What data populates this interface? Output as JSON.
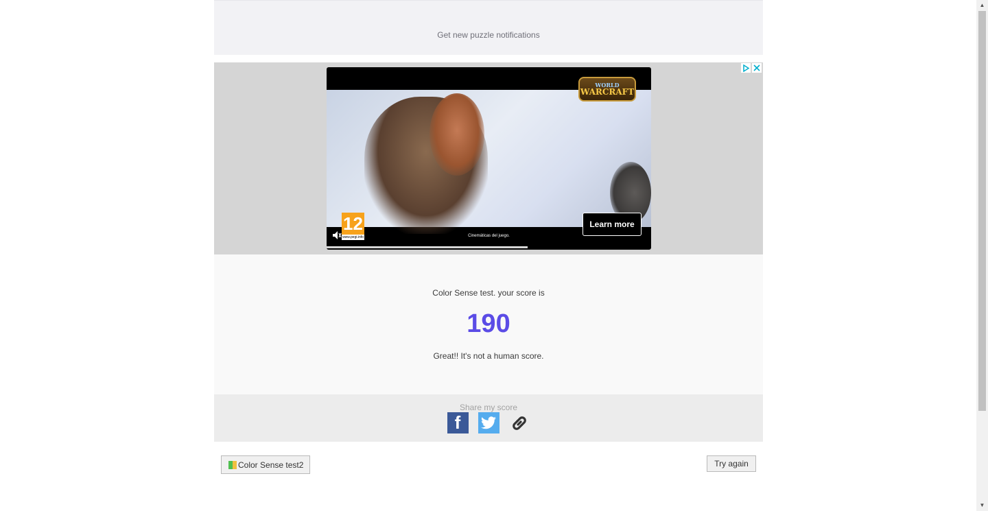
{
  "notify": {
    "text": "Get new puzzle notifications"
  },
  "ad": {
    "logo_line1": "WORLD",
    "logo_line2": "WARCRAFT",
    "rating": "12",
    "rating_site": "www.pegi.info",
    "caption": "Cinemáticas del juego.",
    "cta": "Learn more",
    "progress": 0.62
  },
  "score": {
    "intro": "Color Sense test. your score is",
    "value": "190",
    "comment": "Great!! It's not a human score.",
    "color": "#5b4ce6"
  },
  "share": {
    "label": "Share my score",
    "icons": [
      "facebook-icon",
      "twitter-icon",
      "link-icon"
    ]
  },
  "buttons": {
    "test2": "Color Sense test2",
    "again": "Try again"
  }
}
